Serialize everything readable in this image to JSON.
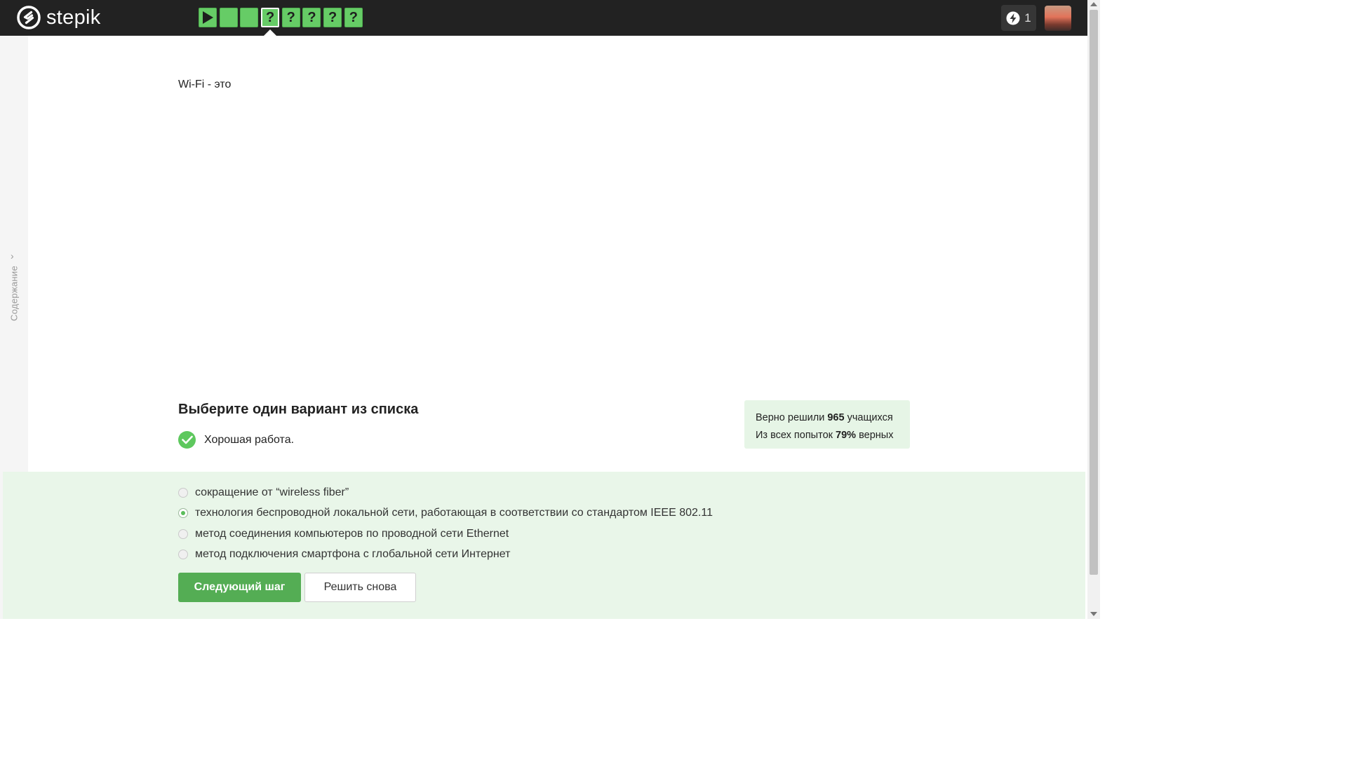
{
  "header": {
    "brand": "stepik",
    "steps": [
      {
        "type": "video",
        "label": ""
      },
      {
        "type": "text",
        "label": ""
      },
      {
        "type": "text",
        "label": ""
      },
      {
        "type": "quiz",
        "label": "?",
        "current": true
      },
      {
        "type": "quiz",
        "label": "?"
      },
      {
        "type": "quiz",
        "label": "?"
      },
      {
        "type": "quiz",
        "label": "?"
      },
      {
        "type": "quiz",
        "label": "?"
      }
    ],
    "streak_count": "1",
    "step_color": "#66cc66"
  },
  "sidebar": {
    "toc_label": "Содержание"
  },
  "lesson": {
    "question": "Wi-Fi - это",
    "task_title": "Выберите один вариант из списка",
    "feedback": "Хорошая работа."
  },
  "stats": {
    "line1_prefix": "Верно решили ",
    "solved_count": "965",
    "line1_suffix": " учащихся",
    "line2_prefix": "Из всех попыток ",
    "correct_percent": "79%",
    "line2_suffix": " верных"
  },
  "options": [
    {
      "label": "сокращение от “wireless fiber”",
      "selected": false
    },
    {
      "label": "технология беспроводной локальной сети, работающая в соответствии со стандартом IEEE 802.11",
      "selected": true
    },
    {
      "label": "метод соединения компьютеров по проводной сети Ethernet",
      "selected": false
    },
    {
      "label": "метод подключения смартфона с глобальной сети Интернет",
      "selected": false
    }
  ],
  "actions": {
    "next_label": "Следующий шаг",
    "retry_label": "Решить снова"
  },
  "colors": {
    "accent": "#54ad54",
    "topbar": "#222222",
    "answers_bg": "#e9f6e9"
  }
}
